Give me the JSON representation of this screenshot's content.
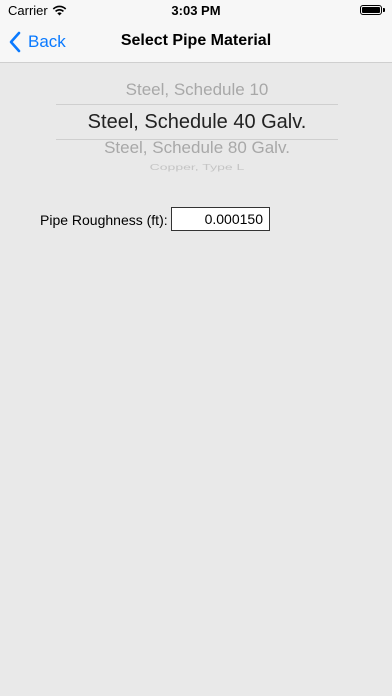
{
  "status_bar": {
    "carrier": "Carrier",
    "time": "3:03 PM",
    "icons": [
      "wifi-icon",
      "battery-icon"
    ]
  },
  "nav": {
    "back_label": "Back",
    "title": "Select Pipe Material",
    "accent_color": "#0a7aff"
  },
  "picker": {
    "items": [
      "Steel, Schedule 10",
      "Steel, Schedule 40 Galv.",
      "Steel, Schedule 80 Galv.",
      "Copper, Type L"
    ],
    "selected": "Steel, Schedule 40 Galv."
  },
  "roughness": {
    "label": "Pipe Roughness (ft):",
    "value": "0.000150"
  }
}
